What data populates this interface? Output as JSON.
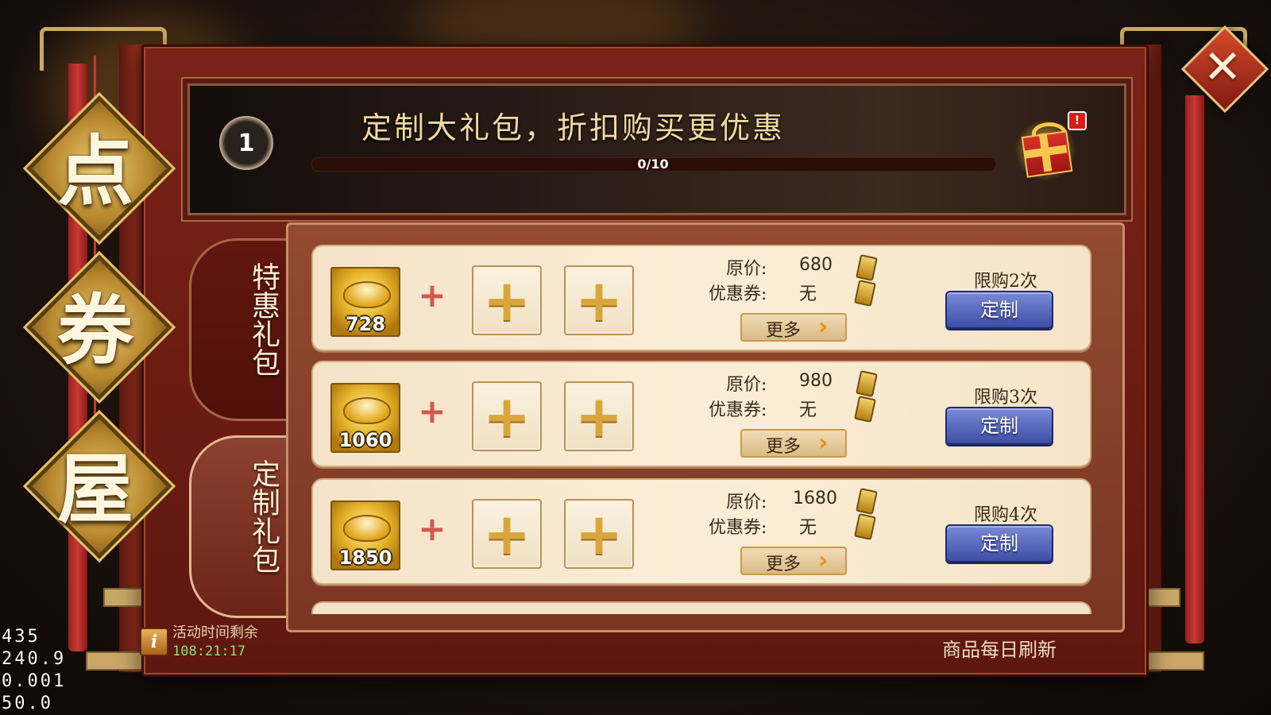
{
  "title_chars": [
    "点",
    "券",
    "屋"
  ],
  "close_label": "✕",
  "banner": {
    "level": "1",
    "title": "定制大礼包，折扣购买更优惠",
    "progress_text": "0/10",
    "progress": 0,
    "notification": "!"
  },
  "tabs": [
    {
      "label": "特惠礼包",
      "active": false
    },
    {
      "label": "定制礼包",
      "active": true
    }
  ],
  "packages": [
    {
      "amount": "728",
      "original_price_label": "原价:",
      "original_price": "680",
      "coupon_label": "优惠券:",
      "coupon_value": "无",
      "more_label": "更多",
      "limit_label": "限购2次",
      "button_label": "定制"
    },
    {
      "amount": "1060",
      "original_price_label": "原价:",
      "original_price": "980",
      "coupon_label": "优惠券:",
      "coupon_value": "无",
      "more_label": "更多",
      "limit_label": "限购3次",
      "button_label": "定制"
    },
    {
      "amount": "1850",
      "original_price_label": "原价:",
      "original_price": "1680",
      "coupon_label": "优惠券:",
      "coupon_value": "无",
      "more_label": "更多",
      "limit_label": "限购4次",
      "button_label": "定制"
    }
  ],
  "footer": {
    "info_icon": "i",
    "timer_label": "活动时间剩余",
    "timer_value": "108:21:17",
    "refresh_note": "商品每日刷新"
  },
  "debug_stats": [
    "435",
    "240.9",
    "0.001",
    "50.0"
  ],
  "colors": {
    "frame_red": "#7a2217",
    "gold": "#c9a768",
    "button_blue": "#3e4ea6",
    "timer_green": "#8ee16c"
  },
  "icons": {
    "close": "close-icon",
    "gift": "gift-box-icon",
    "ingot": "gold-ingot-icon",
    "coupon": "coupon-icon",
    "arrow": "chevron-right-icon",
    "info": "info-icon",
    "plus": "plus-icon"
  }
}
